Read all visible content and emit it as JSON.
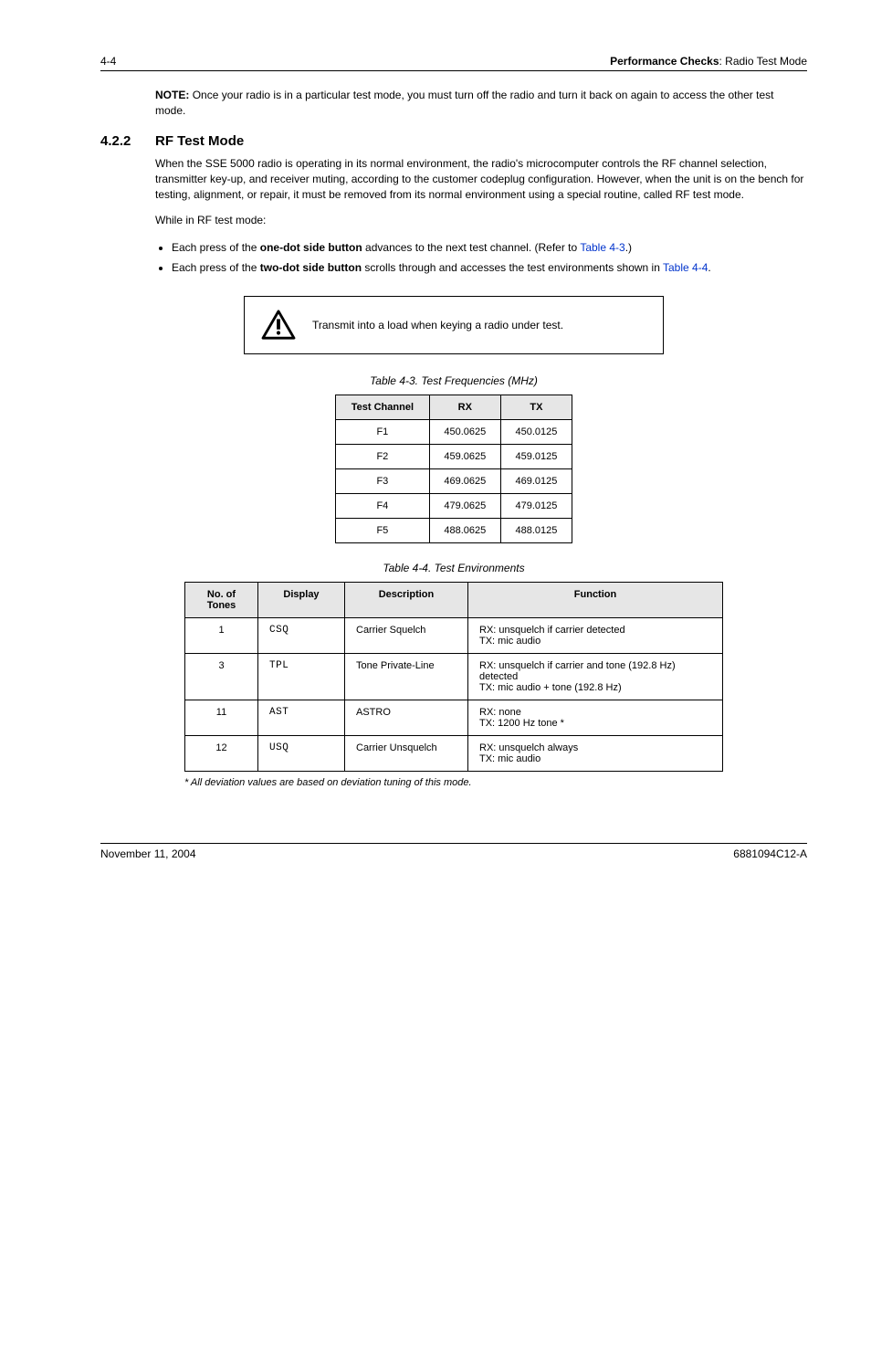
{
  "header": {
    "page_num": "4-4",
    "doc_section_bold": "Performance Checks",
    "doc_section_rest": ": Radio Test Mode"
  },
  "note": {
    "label": "NOTE:",
    "text": "Once your radio is in a particular test mode, you must turn off the radio and turn it back on again to access the other test mode."
  },
  "section": {
    "number": "4.2.2",
    "title": "RF Test Mode",
    "para1": "When the SSE 5000 radio is operating in its normal environment, the radio's microcomputer controls the RF channel selection, transmitter key-up, and receiver muting, according to the customer codeplug configuration. However, when the unit is on the bench for testing, alignment, or repair, it must be removed from its normal environment using a special routine, called RF test mode.",
    "para2": "While in RF test mode:",
    "bullets": [
      {
        "pre": "Each press of the ",
        "bold": "one-dot side button",
        "post": " advances to the next test channel. (Refer to ",
        "link": "Table 4-3",
        "after_link": ".)"
      },
      {
        "pre": "Each press of the ",
        "bold": "two-dot side button",
        "post": " scrolls through and accesses the test environments shown in ",
        "link": "Table 4-4",
        "after_link": "."
      }
    ]
  },
  "caution": {
    "text": "Transmit into a load when keying a radio under test."
  },
  "table_freq": {
    "title": "Table 4-3.  Test Frequencies (MHz)",
    "headers": {
      "ch": "Test Channel",
      "rx": "RX",
      "tx": "TX"
    },
    "rows": [
      {
        "ch": "F1",
        "rx": "450.0625",
        "tx": "450.0125"
      },
      {
        "ch": "F2",
        "rx": "459.0625",
        "tx": "459.0125"
      },
      {
        "ch": "F3",
        "rx": "469.0625",
        "tx": "469.0125"
      },
      {
        "ch": "F4",
        "rx": "479.0625",
        "tx": "479.0125"
      },
      {
        "ch": "F5",
        "rx": "488.0625",
        "tx": "488.0125"
      }
    ]
  },
  "table_env": {
    "title": "Table 4-4.  Test Environments",
    "headers": {
      "tones": "No. of Tones",
      "display": "Display",
      "desc": "Description",
      "func": "Function"
    },
    "rows": [
      {
        "tones": "1",
        "display": "CSQ",
        "desc": "Carrier Squelch",
        "func": "RX: unsquelch if carrier detected\nTX: mic audio"
      },
      {
        "tones": "3",
        "display": "TPL",
        "desc": "Tone Private-Line",
        "func": "RX: unsquelch if carrier and tone (192.8 Hz) detected\nTX: mic audio + tone (192.8 Hz)"
      },
      {
        "tones": "11",
        "display": "AST",
        "desc": "ASTRO",
        "func": "RX: none\nTX: 1200 Hz tone *"
      },
      {
        "tones": "12",
        "display": "USQ",
        "desc": "Carrier Unsquelch",
        "func": "RX: unsquelch always\nTX: mic audio"
      }
    ],
    "footnote": "*   All deviation values are based on deviation tuning of this mode."
  },
  "footer": {
    "date": "November 11, 2004",
    "docnum": "6881094C12-A"
  }
}
